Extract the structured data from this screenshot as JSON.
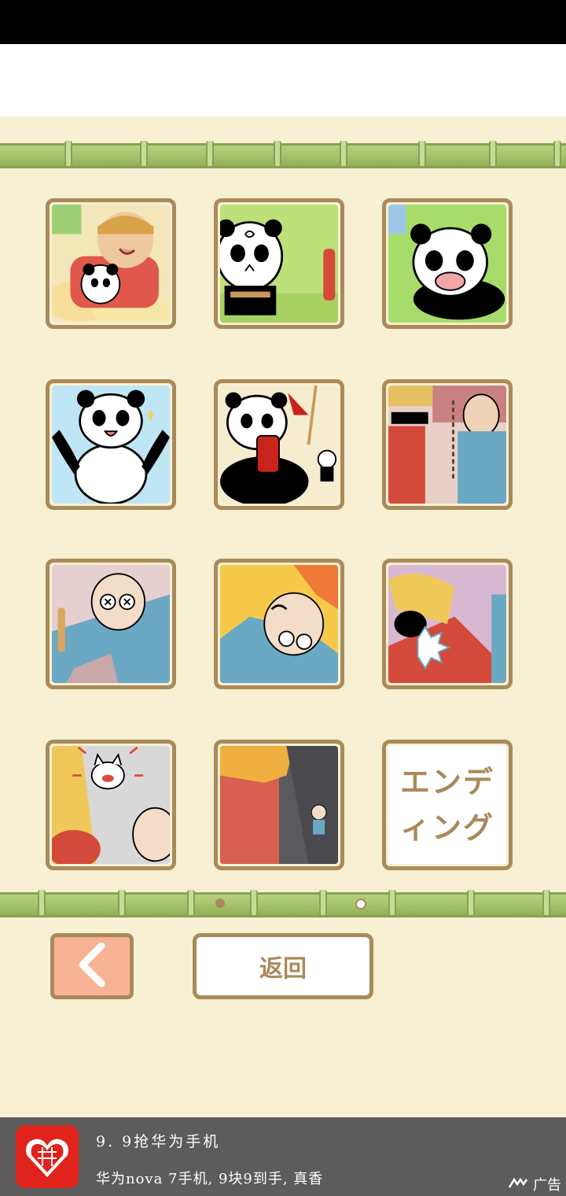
{
  "gallery": {
    "tiles": [
      {
        "name": "tile-monkey-king-panda"
      },
      {
        "name": "tile-dizzy-panda"
      },
      {
        "name": "tile-crying-panda"
      },
      {
        "name": "tile-happy-panda"
      },
      {
        "name": "tile-panda-dynamite"
      },
      {
        "name": "tile-worker-and-sunglasses"
      },
      {
        "name": "tile-knocked-out-man"
      },
      {
        "name": "tile-man-in-fire"
      },
      {
        "name": "tile-punched-worker"
      },
      {
        "name": "tile-angry-cat"
      },
      {
        "name": "tile-dark-room"
      }
    ],
    "ending_label": "エンデ\nィング"
  },
  "controls": {
    "back_arrow": "chevron-left-icon",
    "return_label": "返回"
  },
  "ad": {
    "title": "9. 9抢华为手机",
    "subtitle": "华为nova 7手机, 9块9到手, 真香",
    "badge_label": "广告",
    "logo_icon": "pinduoduo-logo-icon"
  },
  "colors": {
    "background": "#f7f0d2",
    "frame_brown": "#a98a5a",
    "bamboo_green": "#a9c56f",
    "back_button": "#f7b394",
    "ad_bar": "#5c5c5c",
    "ad_logo": "#e0231c"
  }
}
